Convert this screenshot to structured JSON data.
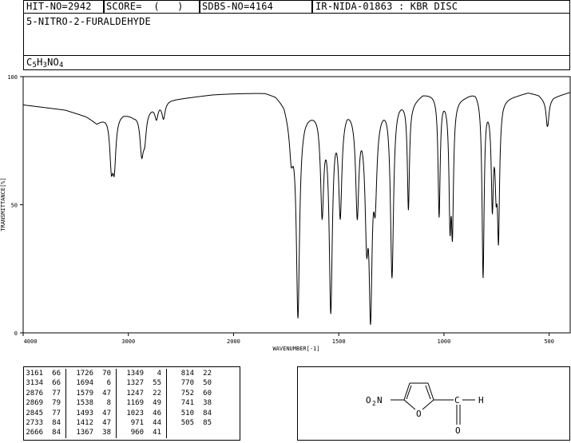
{
  "header": {
    "hit_no": "HIT-NO=2942",
    "score": "SCORE=  (   )",
    "sdbs_no": "SDBS-NO=4164",
    "ir_info": "IR-NIDA-01863 : KBR DISC",
    "compound_name": "5-NITRO-2-FURALDEHYDE",
    "formula_parts": [
      {
        "t": "C",
        "sub": false
      },
      {
        "t": "5",
        "sub": true
      },
      {
        "t": "H",
        "sub": false
      },
      {
        "t": "3",
        "sub": true
      },
      {
        "t": "NO",
        "sub": false
      },
      {
        "t": "4",
        "sub": true
      }
    ]
  },
  "chart_data": {
    "type": "line",
    "title": "",
    "xlabel": "WAVENUMBER[-1]",
    "ylabel": "TRANSMITTANCE[%]",
    "xlim": [
      4000,
      400
    ],
    "ylim": [
      0,
      100
    ],
    "x_ticks": [
      4000,
      3000,
      2000,
      1500,
      1000,
      500
    ],
    "y_ticks": [
      0,
      50,
      100
    ],
    "grid": false,
    "legend": "none",
    "line_color": "#000000",
    "baseline": [
      [
        4000,
        89
      ],
      [
        3800,
        88
      ],
      [
        3600,
        87
      ],
      [
        3400,
        84.5
      ],
      [
        3300,
        82
      ],
      [
        3200,
        85
      ],
      [
        3050,
        86
      ],
      [
        2950,
        85
      ],
      [
        2800,
        88
      ],
      [
        2700,
        90
      ],
      [
        2600,
        91
      ],
      [
        2400,
        92
      ],
      [
        2200,
        93
      ],
      [
        2000,
        93.5
      ],
      [
        1850,
        94
      ],
      [
        1800,
        93
      ],
      [
        1760,
        90
      ],
      [
        1720,
        80
      ],
      [
        1660,
        86
      ],
      [
        1600,
        88
      ],
      [
        1560,
        86
      ],
      [
        1500,
        87
      ],
      [
        1460,
        90
      ],
      [
        1400,
        88
      ],
      [
        1350,
        86
      ],
      [
        1300,
        90
      ],
      [
        1250,
        93
      ],
      [
        1200,
        92
      ],
      [
        1150,
        91
      ],
      [
        1100,
        94
      ],
      [
        1050,
        94
      ],
      [
        1000,
        93
      ],
      [
        950,
        92
      ],
      [
        900,
        93
      ],
      [
        850,
        95
      ],
      [
        800,
        92
      ],
      [
        760,
        88
      ],
      [
        720,
        92
      ],
      [
        650,
        93
      ],
      [
        600,
        94
      ],
      [
        550,
        93
      ],
      [
        510,
        90
      ],
      [
        480,
        92
      ],
      [
        440,
        93
      ],
      [
        400,
        94
      ]
    ],
    "peaks": [
      {
        "x": 3161,
        "y": 66
      },
      {
        "x": 3134,
        "y": 66
      },
      {
        "x": 2876,
        "y": 77
      },
      {
        "x": 2869,
        "y": 79
      },
      {
        "x": 2845,
        "y": 77
      },
      {
        "x": 2733,
        "y": 84
      },
      {
        "x": 2666,
        "y": 84
      },
      {
        "x": 1726,
        "y": 70
      },
      {
        "x": 1694,
        "y": 6
      },
      {
        "x": 1579,
        "y": 47
      },
      {
        "x": 1538,
        "y": 8
      },
      {
        "x": 1493,
        "y": 47
      },
      {
        "x": 1412,
        "y": 47
      },
      {
        "x": 1367,
        "y": 38
      },
      {
        "x": 1349,
        "y": 4
      },
      {
        "x": 1327,
        "y": 55
      },
      {
        "x": 1247,
        "y": 22
      },
      {
        "x": 1169,
        "y": 49
      },
      {
        "x": 1023,
        "y": 46
      },
      {
        "x": 971,
        "y": 44
      },
      {
        "x": 960,
        "y": 41
      },
      {
        "x": 814,
        "y": 22
      },
      {
        "x": 770,
        "y": 50
      },
      {
        "x": 752,
        "y": 60
      },
      {
        "x": 741,
        "y": 38
      },
      {
        "x": 510,
        "y": 84
      },
      {
        "x": 505,
        "y": 85
      }
    ]
  },
  "peak_table": {
    "columns": [
      [
        [
          "3161",
          "66"
        ],
        [
          "3134",
          "66"
        ],
        [
          "2876",
          "77"
        ],
        [
          "2869",
          "79"
        ],
        [
          "2845",
          "77"
        ],
        [
          "2733",
          "84"
        ],
        [
          "2666",
          "84"
        ]
      ],
      [
        [
          "1726",
          "70"
        ],
        [
          "1694",
          "6"
        ],
        [
          "1579",
          "47"
        ],
        [
          "1538",
          "8"
        ],
        [
          "1493",
          "47"
        ],
        [
          "1412",
          "47"
        ],
        [
          "1367",
          "38"
        ]
      ],
      [
        [
          "1349",
          "4"
        ],
        [
          "1327",
          "55"
        ],
        [
          "1247",
          "22"
        ],
        [
          "1169",
          "49"
        ],
        [
          "1023",
          "46"
        ],
        [
          "971",
          "44"
        ],
        [
          "960",
          "41"
        ]
      ],
      [
        [
          "814",
          "22"
        ],
        [
          "770",
          "50"
        ],
        [
          "752",
          "60"
        ],
        [
          "741",
          "38"
        ],
        [
          "510",
          "84"
        ],
        [
          "505",
          "85"
        ],
        [
          "",
          ""
        ]
      ]
    ]
  },
  "structure": {
    "substituent_left": "O",
    "substituent_left_sub": "2",
    "substituent_left_end": "N",
    "ring_oxygen": "O",
    "aldehyde_carbon": "C",
    "aldehyde_hydrogen": "H",
    "aldehyde_oxygen": "O"
  }
}
